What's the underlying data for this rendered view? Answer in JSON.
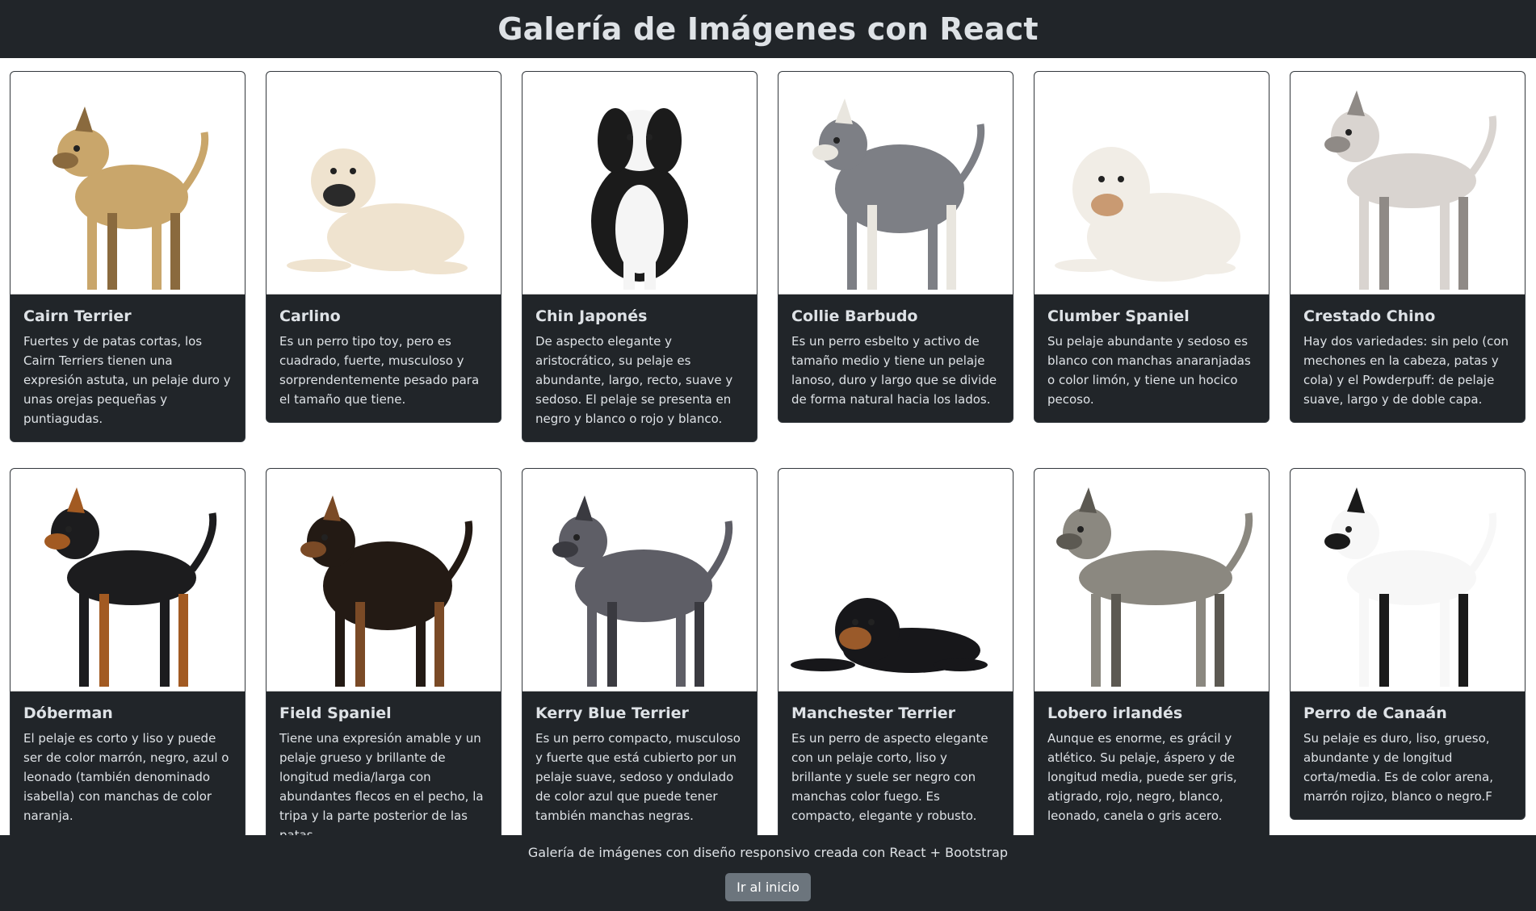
{
  "header": {
    "title": "Galería de Imágenes con React"
  },
  "cards": [
    {
      "name": "Cairn Terrier",
      "description": "Fuertes y de patas cortas, los Cairn Terriers tienen una expresión astuta, un pelaje duro y unas orejas pequeñas y puntiagudas.",
      "icon": "cairn-terrier-photo",
      "coat": "#c9a66b",
      "accent": "#8a6a3e",
      "pose": "stand-small"
    },
    {
      "name": "Carlino",
      "description": "Es un perro tipo toy, pero es cuadrado, fuerte, musculoso y sorprendentemente pesado para el tamaño que tiene.",
      "icon": "carlino-photo",
      "coat": "#efe3cf",
      "accent": "#2a2a2a",
      "pose": "lying"
    },
    {
      "name": "Chin Japonés",
      "description": "De aspecto elegante y aristocrático, su pelaje es abundante, largo, recto, suave y sedoso. El pelaje se presenta en negro y blanco o rojo y blanco.",
      "icon": "chin-japones-photo",
      "coat": "#f5f5f5",
      "accent": "#1b1b1b",
      "pose": "sit"
    },
    {
      "name": "Collie Barbudo",
      "description": "Es un perro esbelto y activo de tamaño medio y tiene un pelaje lanoso, duro y largo que se divide de forma natural hacia los lados.",
      "icon": "collie-barbudo-photo",
      "coat": "#7d7f85",
      "accent": "#e9e6df",
      "pose": "stand-shaggy"
    },
    {
      "name": "Clumber Spaniel",
      "description": "Su pelaje abundante y sedoso es blanco con manchas anaranjadas o color limón, y tiene un hocico pecoso.",
      "icon": "clumber-spaniel-photo",
      "coat": "#f1ede6",
      "accent": "#c99a72",
      "pose": "lying-big"
    },
    {
      "name": "Crestado Chino",
      "description": "Hay dos variedades: sin pelo (con mechones en la cabeza, patas y cola) y el Powderpuff: de pelaje suave, largo y de doble capa.",
      "icon": "crestado-chino-photo",
      "coat": "#d9d4d0",
      "accent": "#8f8a86",
      "pose": "stand-thin"
    },
    {
      "name": "Dóberman",
      "description": "El pelaje es corto y liso y puede ser de color marrón, negro, azul o leonado (también denominado isabella) con manchas de color naranja.",
      "icon": "doberman-photo",
      "coat": "#1c1c1e",
      "accent": "#a25a22",
      "pose": "stand-tall"
    },
    {
      "name": "Field Spaniel",
      "description": "Tiene una expresión amable y un pelaje grueso y brillante de longitud media/larga con abundantes flecos en el pecho, la tripa y la parte posterior de las patas.",
      "icon": "field-spaniel-photo",
      "coat": "#231a14",
      "accent": "#7a4a26",
      "pose": "stand-shaggy"
    },
    {
      "name": "Kerry Blue Terrier",
      "description": "Es un perro compacto, musculoso y fuerte que está cubierto por un pelaje suave, sedoso y ondulado de color azul que puede tener también manchas negras.",
      "icon": "kerry-blue-terrier-photo",
      "coat": "#5e5e66",
      "accent": "#3a3a40",
      "pose": "stand-block"
    },
    {
      "name": "Manchester Terrier",
      "description": "Es un perro de aspecto elegante con un pelaje corto, liso y brillante y suele ser negro con manchas color fuego. Es compacto, elegante y robusto.",
      "icon": "manchester-terrier-photo",
      "coat": "#17171a",
      "accent": "#9a5a2a",
      "pose": "lying-low"
    },
    {
      "name": "Lobero irlandés",
      "description": "Aunque es enorme, es grácil y atlético. Su pelaje, áspero y de longitud media, puede ser gris, atigrado, rojo, negro, blanco, leonado, canela o gris acero.",
      "icon": "lobero-irlandes-photo",
      "coat": "#8b8880",
      "accent": "#5c5952",
      "pose": "stand-long"
    },
    {
      "name": "Perro de Canaán",
      "description": "Su pelaje es duro, liso, grueso, abundante y de longitud corta/media. Es de color arena, marrón rojizo, blanco o negro.F",
      "icon": "perro-de-canaan-photo",
      "coat": "#f7f7f7",
      "accent": "#1a1a1a",
      "pose": "stand-thin"
    }
  ],
  "footer": {
    "text": "Galería de imágenes con diseño responsivo creada con React + Bootstrap",
    "button_label": "Ir al inicio"
  },
  "colors": {
    "dark": "#212529",
    "card_text": "#dee2e6",
    "button": "#6c757d"
  }
}
